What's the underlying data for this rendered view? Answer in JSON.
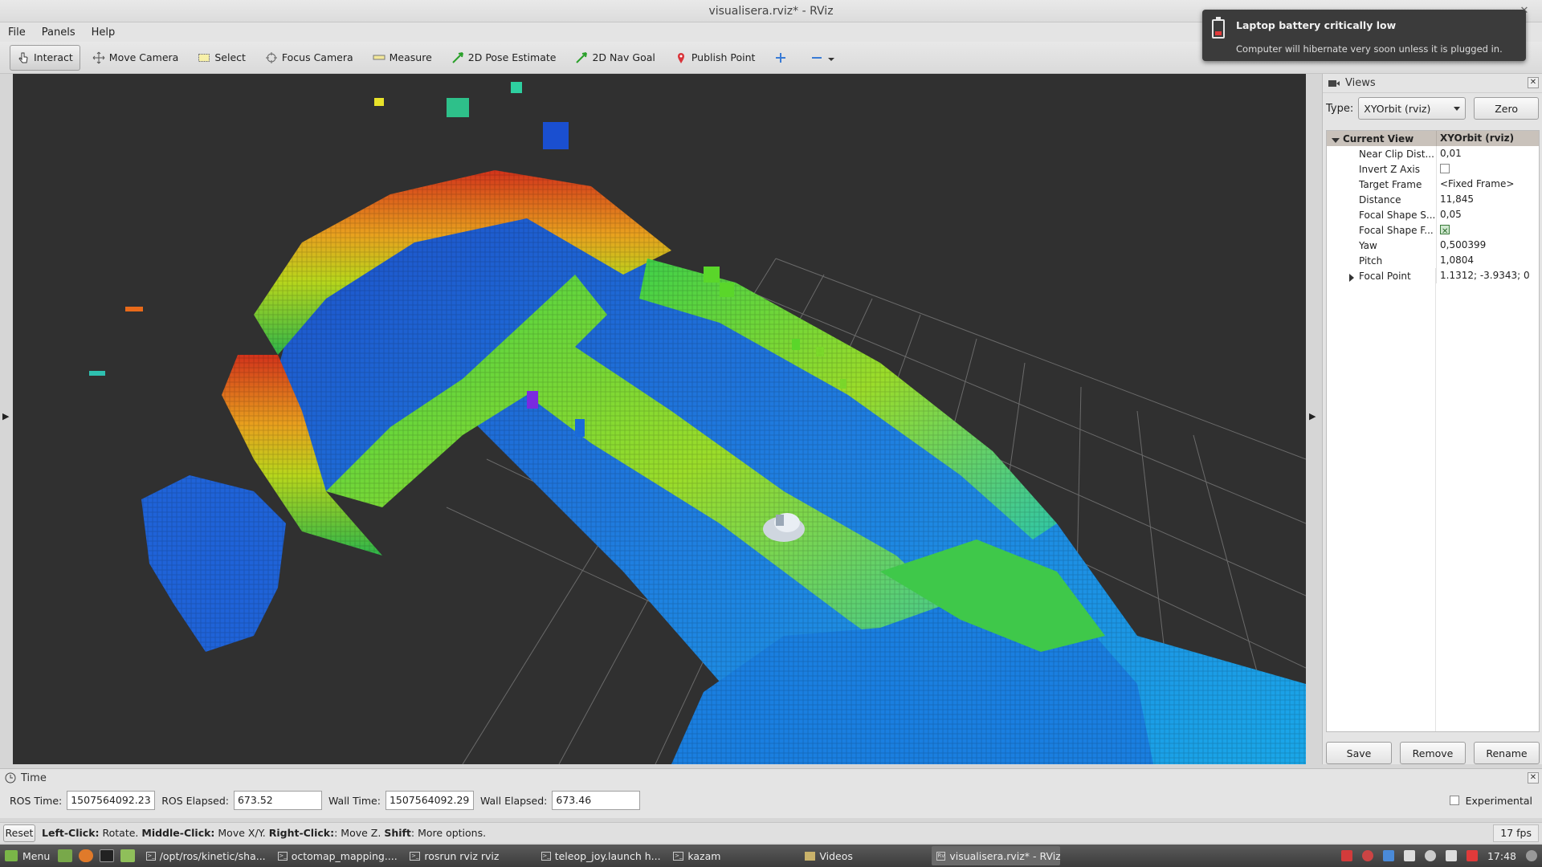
{
  "window": {
    "title": "visualisera.rviz* - RViz"
  },
  "menu": {
    "items": [
      {
        "label": "File"
      },
      {
        "label": "Panels"
      },
      {
        "label": "Help"
      }
    ]
  },
  "toolbar": {
    "tools": [
      {
        "label": "Interact",
        "icon": "hand-cursor-icon",
        "active": true
      },
      {
        "label": "Move Camera",
        "icon": "move-arrows-icon"
      },
      {
        "label": "Select",
        "icon": "select-rect-icon"
      },
      {
        "label": "Focus Camera",
        "icon": "crosshair-icon"
      },
      {
        "label": "Measure",
        "icon": "ruler-icon"
      },
      {
        "label": "2D Pose Estimate",
        "icon": "green-arrow-icon"
      },
      {
        "label": "2D Nav Goal",
        "icon": "green-arrow-icon"
      },
      {
        "label": "Publish Point",
        "icon": "map-pin-icon"
      }
    ],
    "extra_icons": [
      "plus-icon",
      "minus-icon",
      "dropdown-arrow-icon"
    ]
  },
  "notification": {
    "title": "Laptop battery critically low",
    "body": "Computer will hibernate very soon unless it is plugged in."
  },
  "views_panel": {
    "title": "Views",
    "type_label": "Type:",
    "type_value": "XYOrbit (rviz)",
    "zero_label": "Zero",
    "current_view": {
      "name": "Current View",
      "value": "XYOrbit (rviz)"
    },
    "properties": [
      {
        "name": "Near Clip Dist...",
        "value": "0,01"
      },
      {
        "name": "Invert Z Axis",
        "checkbox": false
      },
      {
        "name": "Target Frame",
        "value": "<Fixed Frame>"
      },
      {
        "name": "Distance",
        "value": "11,845"
      },
      {
        "name": "Focal Shape S...",
        "value": "0,05"
      },
      {
        "name": "Focal Shape F...",
        "checkbox": true
      },
      {
        "name": "Yaw",
        "value": "0,500399"
      },
      {
        "name": "Pitch",
        "value": "1,0804"
      },
      {
        "name": "Focal Point",
        "value": "1.1312; -3.9343; 0",
        "expandable": true
      }
    ],
    "buttons": {
      "save": "Save",
      "remove": "Remove",
      "rename": "Rename"
    }
  },
  "time_panel": {
    "title": "Time",
    "ros_time_label": "ROS Time:",
    "ros_time": "1507564092.23",
    "ros_elapsed_label": "ROS Elapsed:",
    "ros_elapsed": "673.52",
    "wall_time_label": "Wall Time:",
    "wall_time": "1507564092.29",
    "wall_elapsed_label": "Wall Elapsed:",
    "wall_elapsed": "673.46",
    "experimental_label": "Experimental"
  },
  "status_bar": {
    "reset_label": "Reset",
    "hint_left_bold": "Left-Click:",
    "hint_left": " Rotate. ",
    "hint_middle_bold": "Middle-Click:",
    "hint_middle": " Move X/Y. ",
    "hint_right_bold": "Right-Click:",
    "hint_right": ": Move Z. ",
    "hint_shift_bold": "Shift",
    "hint_shift": ": More options.",
    "fps": "17 fps"
  },
  "taskbar": {
    "menu_label": "Menu",
    "tasks": [
      {
        "label": "/opt/ros/kinetic/sha..."
      },
      {
        "label": "octomap_mapping...."
      },
      {
        "label": "rosrun rviz rviz"
      },
      {
        "label": "teleop_joy.launch h..."
      },
      {
        "label": "kazam"
      },
      {
        "label": "Videos"
      },
      {
        "label": "visualisera.rviz* - RViz",
        "active": true
      }
    ],
    "clock": "17:48"
  },
  "colors": {
    "viewport_bg": "#303030",
    "grid": "#6a6a6a",
    "selected_row": "#c9c2bb"
  }
}
